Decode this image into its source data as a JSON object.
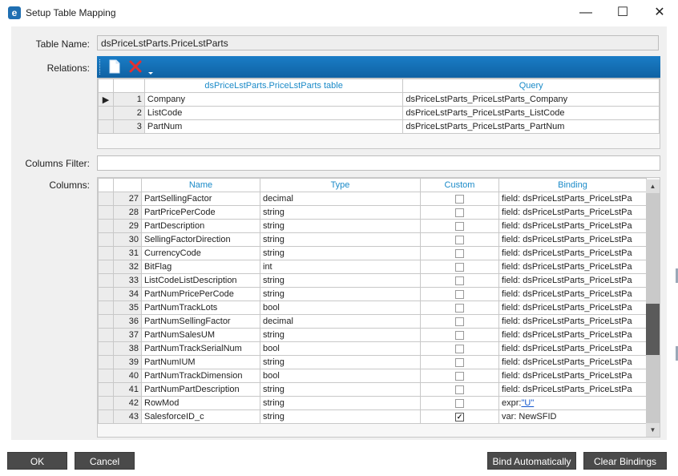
{
  "window": {
    "title": "Setup Table Mapping",
    "app_icon_letter": "e",
    "min_glyph": "—",
    "max_glyph": "☐",
    "close_glyph": "✕"
  },
  "labels": {
    "table_name": "Table Name:",
    "relations": "Relations:",
    "columns_filter": "Columns Filter:",
    "columns": "Columns:"
  },
  "table_name_value": "dsPriceLstParts.PriceLstParts",
  "relations_toolbar": {
    "new_icon": "new-document-icon",
    "delete_icon": "delete-x-icon",
    "dropdown_icon": "chevron-down-icon"
  },
  "relations": {
    "headers": [
      "dsPriceLstParts.PriceLstParts table",
      "Query"
    ],
    "rows": [
      {
        "num": "1",
        "field": "Company",
        "query": "dsPriceLstParts_PriceLstParts_Company",
        "selected": true
      },
      {
        "num": "2",
        "field": "ListCode",
        "query": "dsPriceLstParts_PriceLstParts_ListCode",
        "selected": false
      },
      {
        "num": "3",
        "field": "PartNum",
        "query": "dsPriceLstParts_PriceLstParts_PartNum",
        "selected": false
      }
    ]
  },
  "columns_filter_value": "",
  "columns": {
    "headers": [
      "Name",
      "Type",
      "Custom",
      "Binding"
    ],
    "rows": [
      {
        "num": "27",
        "name": "PartSellingFactor",
        "type": "decimal",
        "custom": false,
        "binding": "field: dsPriceLstParts_PriceLstPa"
      },
      {
        "num": "28",
        "name": "PartPricePerCode",
        "type": "string",
        "custom": false,
        "binding": "field: dsPriceLstParts_PriceLstPa"
      },
      {
        "num": "29",
        "name": "PartDescription",
        "type": "string",
        "custom": false,
        "binding": "field: dsPriceLstParts_PriceLstPa"
      },
      {
        "num": "30",
        "name": "SellingFactorDirection",
        "type": "string",
        "custom": false,
        "binding": "field: dsPriceLstParts_PriceLstPa"
      },
      {
        "num": "31",
        "name": "CurrencyCode",
        "type": "string",
        "custom": false,
        "binding": "field: dsPriceLstParts_PriceLstPa"
      },
      {
        "num": "32",
        "name": "BitFlag",
        "type": "int",
        "custom": false,
        "binding": "field: dsPriceLstParts_PriceLstPa"
      },
      {
        "num": "33",
        "name": "ListCodeListDescription",
        "type": "string",
        "custom": false,
        "binding": "field: dsPriceLstParts_PriceLstPa"
      },
      {
        "num": "34",
        "name": "PartNumPricePerCode",
        "type": "string",
        "custom": false,
        "binding": "field: dsPriceLstParts_PriceLstPa"
      },
      {
        "num": "35",
        "name": "PartNumTrackLots",
        "type": "bool",
        "custom": false,
        "binding": "field: dsPriceLstParts_PriceLstPa"
      },
      {
        "num": "36",
        "name": "PartNumSellingFactor",
        "type": "decimal",
        "custom": false,
        "binding": "field: dsPriceLstParts_PriceLstPa"
      },
      {
        "num": "37",
        "name": "PartNumSalesUM",
        "type": "string",
        "custom": false,
        "binding": "field: dsPriceLstParts_PriceLstPa"
      },
      {
        "num": "38",
        "name": "PartNumTrackSerialNum",
        "type": "bool",
        "custom": false,
        "binding": "field: dsPriceLstParts_PriceLstPa"
      },
      {
        "num": "39",
        "name": "PartNumIUM",
        "type": "string",
        "custom": false,
        "binding": "field: dsPriceLstParts_PriceLstPa"
      },
      {
        "num": "40",
        "name": "PartNumTrackDimension",
        "type": "bool",
        "custom": false,
        "binding": "field: dsPriceLstParts_PriceLstPa"
      },
      {
        "num": "41",
        "name": "PartNumPartDescription",
        "type": "string",
        "custom": false,
        "binding": "field: dsPriceLstParts_PriceLstPa"
      },
      {
        "num": "42",
        "name": "RowMod",
        "type": "string",
        "custom": false,
        "binding": "expr:",
        "binding_link": "\"U\""
      },
      {
        "num": "43",
        "name": "SalesforceID_c",
        "type": "string",
        "custom": true,
        "binding": "var: NewSFID"
      }
    ],
    "scrollbar": {
      "up_glyph": "▲",
      "down_glyph": "▼",
      "position_fraction": 0.62
    }
  },
  "buttons": {
    "ok": "OK",
    "cancel": "Cancel",
    "bind_automatically": "Bind Automatically",
    "clear_bindings": "Clear Bindings"
  },
  "colors": {
    "toolbar_blue": "#1a7cc6",
    "header_text": "#1a8ac8",
    "button_dark": "#4a4a4a"
  }
}
